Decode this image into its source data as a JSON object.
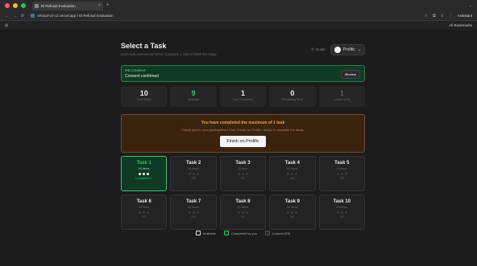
{
  "browser": {
    "tab_title": "El Refusal Evaluation",
    "url": "refusal-v2-c2.vercel.app / El Refusal Evaluation",
    "assistant_label": "Assistant",
    "bookmarks_label": "All Bookmarks",
    "icons": {
      "back": "←",
      "forward": "→",
      "reload": "⟳",
      "new_tab": "+",
      "close_tab": "×",
      "menu": "⌄",
      "grid": "⊞",
      "star": "☆",
      "extension": "⧉",
      "download": "⇩",
      "more": "⋮"
    }
  },
  "header": {
    "title": "Select a Task",
    "subtitle": "Each task contains 60 items. Complete 1 task to finish the study.",
    "guide_label": "Guide",
    "prolific_label": "Prolific",
    "prolific_chevron": "⌄",
    "guide_icon": "⓪"
  },
  "consent": {
    "label": "IRB CONSENT",
    "text": "Consent confirmed",
    "review_label": "Review"
  },
  "stats": [
    {
      "value": "10",
      "label": "Total Tasks",
      "style": "normal"
    },
    {
      "value": "9",
      "label": "Available",
      "style": "green"
    },
    {
      "value": "1",
      "label": "Your Completed",
      "style": "normal"
    },
    {
      "value": "0",
      "label": "Remaining Slots",
      "style": "normal"
    },
    {
      "value": "1",
      "label": "Locked (3/3)",
      "style": "dim"
    }
  ],
  "limit": {
    "title": "You have completed the maximum of 1 task",
    "text": "Thank you for your participation! Click \"Finish on Prolific\" below to complete the study.",
    "button_label": "Finish on Prolific"
  },
  "tasks": [
    {
      "title": "Task 1",
      "items": "60 items",
      "status": "Completed ✓",
      "done": true
    },
    {
      "title": "Task 2",
      "items": "60 items",
      "status": "0/3",
      "done": false
    },
    {
      "title": "Task 3",
      "items": "60 items",
      "status": "0/3",
      "done": false
    },
    {
      "title": "Task 4",
      "items": "60 items",
      "status": "0/3",
      "done": false
    },
    {
      "title": "Task 5",
      "items": "60 items",
      "status": "0/3",
      "done": false
    },
    {
      "title": "Task 6",
      "items": "60 items",
      "status": "0/3",
      "done": false
    },
    {
      "title": "Task 7",
      "items": "60 items",
      "status": "0/3",
      "done": false
    },
    {
      "title": "Task 8",
      "items": "60 items",
      "status": "0/3",
      "done": false
    },
    {
      "title": "Task 9",
      "items": "60 items",
      "status": "0/3",
      "done": false
    },
    {
      "title": "Task 10",
      "items": "60 items",
      "status": "0/3",
      "done": false
    }
  ],
  "legend": {
    "available": "Available",
    "completed": "Completed by you",
    "locked": "Locked (3/3)"
  },
  "colors": {
    "accent_green": "#34c26a",
    "warning_orange": "#f2a24a",
    "background": "#1c1c1e"
  }
}
